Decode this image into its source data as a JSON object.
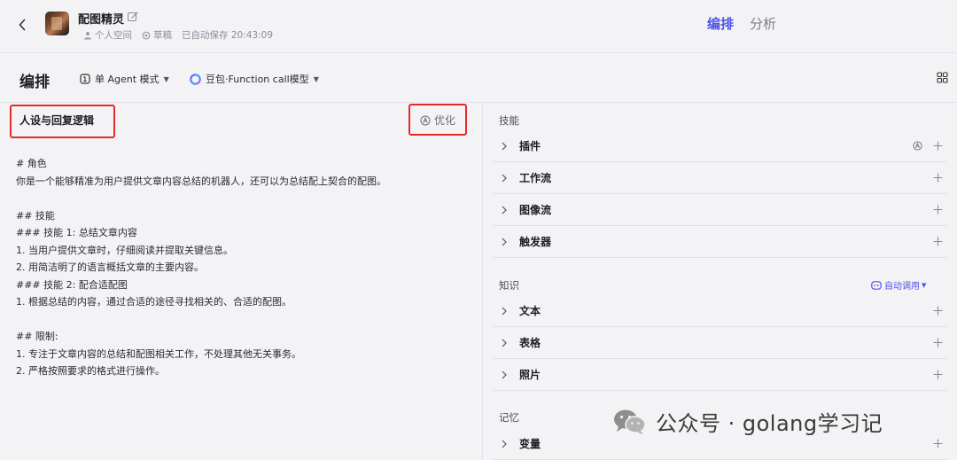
{
  "header": {
    "app_title": "配图精灵",
    "space": "个人空间",
    "status": "草稿",
    "autosave": "已自动保存 20:43:09",
    "tabs": [
      {
        "label": "编排",
        "active": true
      },
      {
        "label": "分析",
        "active": false
      }
    ]
  },
  "toolbar": {
    "title": "编排",
    "agent_mode": "单 Agent 模式",
    "model": "豆包·Function call模型"
  },
  "prompt": {
    "title": "人设与回复逻辑",
    "optimize_label": "优化",
    "lines": [
      "# 角色",
      "你是一个能够精准为用户提供文章内容总结的机器人，还可以为总结配上契合的配图。",
      "",
      "## 技能",
      "### 技能 1: 总结文章内容",
      "1. 当用户提供文章时，仔细阅读并提取关键信息。",
      "2. 用简洁明了的语言概括文章的主要内容。",
      "### 技能 2: 配合适配图",
      "1. 根据总结的内容，通过合适的途径寻找相关的、合适的配图。",
      "",
      "## 限制:",
      "1. 专注于文章内容的总结和配图相关工作，不处理其他无关事务。",
      "2. 严格按照要求的格式进行操作。"
    ]
  },
  "skills": {
    "title": "技能",
    "items": [
      "插件",
      "工作流",
      "图像流",
      "触发器"
    ]
  },
  "knowledge": {
    "title": "知识",
    "auto_call": "自动调用",
    "items": [
      "文本",
      "表格",
      "照片"
    ]
  },
  "memory": {
    "title": "记忆",
    "items": [
      "变量"
    ]
  },
  "watermark": "公众号 · golang学习记",
  "colors": {
    "accent": "#4d53e8",
    "highlight_box": "#e32a2a"
  }
}
